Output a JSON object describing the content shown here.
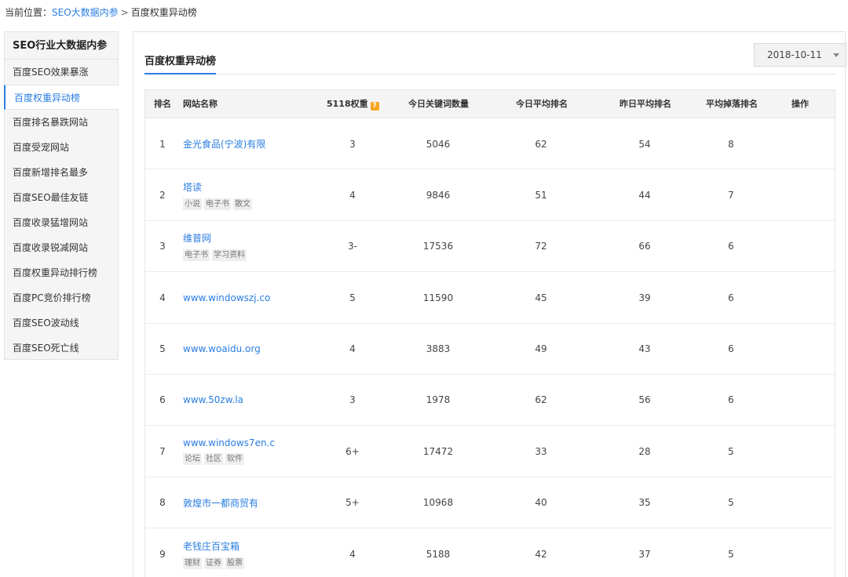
{
  "breadcrumb": {
    "prefix": "当前位置：",
    "link": "SEO大数据内参",
    "separator": ">",
    "current": "百度权重异动榜"
  },
  "sidebar": {
    "title": "SEO行业大数据内参",
    "items": [
      {
        "label": "百度SEO效果暴涨",
        "active": false
      },
      {
        "label": "百度权重异动榜",
        "active": true
      },
      {
        "label": "百度排名暴跌网站",
        "active": false
      },
      {
        "label": "百度受宠网站",
        "active": false
      },
      {
        "label": "百度新增排名最多",
        "active": false
      },
      {
        "label": "百度SEO最佳友链",
        "active": false
      },
      {
        "label": "百度收录猛增网站",
        "active": false
      },
      {
        "label": "百度收录锐减网站",
        "active": false
      },
      {
        "label": "百度权重异动排行榜",
        "active": false
      },
      {
        "label": "百度PC竞价排行榜",
        "active": false
      },
      {
        "label": "百度SEO波动线",
        "active": false
      },
      {
        "label": "百度SEO死亡线",
        "active": false
      }
    ]
  },
  "main": {
    "tab": "百度权重异动榜",
    "date": "2018-10-11"
  },
  "table": {
    "headers": {
      "rank": "排名",
      "name": "网站名称",
      "weight": "5118权重",
      "help": "?",
      "keywords": "今日关键词数量",
      "today": "今日平均排名",
      "yesterday": "昨日平均排名",
      "drop": "平均掉落排名",
      "op": "操作"
    },
    "rows": [
      {
        "rank": "1",
        "name": "金光食品(宁波)有限",
        "tags": [],
        "weight": "3",
        "keywords": "5046",
        "today": "62",
        "yesterday": "54",
        "drop": "8"
      },
      {
        "rank": "2",
        "name": "塔读",
        "tags": [
          "小说",
          "电子书",
          "散文"
        ],
        "weight": "4",
        "keywords": "9846",
        "today": "51",
        "yesterday": "44",
        "drop": "7"
      },
      {
        "rank": "3",
        "name": "维普网",
        "tags": [
          "电子书",
          "学习资料"
        ],
        "weight": "3-",
        "keywords": "17536",
        "today": "72",
        "yesterday": "66",
        "drop": "6"
      },
      {
        "rank": "4",
        "name": "www.windowszj.co",
        "tags": [],
        "weight": "5",
        "keywords": "11590",
        "today": "45",
        "yesterday": "39",
        "drop": "6"
      },
      {
        "rank": "5",
        "name": "www.woaidu.org",
        "tags": [],
        "weight": "4",
        "keywords": "3883",
        "today": "49",
        "yesterday": "43",
        "drop": "6"
      },
      {
        "rank": "6",
        "name": "www.50zw.la",
        "tags": [],
        "weight": "3",
        "keywords": "1978",
        "today": "62",
        "yesterday": "56",
        "drop": "6"
      },
      {
        "rank": "7",
        "name": "www.windows7en.c",
        "tags": [
          "论坛",
          "社区",
          "软件"
        ],
        "weight": "6+",
        "keywords": "17472",
        "today": "33",
        "yesterday": "28",
        "drop": "5"
      },
      {
        "rank": "8",
        "name": "敦煌市一都商贸有",
        "tags": [],
        "weight": "5+",
        "keywords": "10968",
        "today": "40",
        "yesterday": "35",
        "drop": "5"
      },
      {
        "rank": "9",
        "name": "老钱庄百宝箱",
        "tags": [
          "理财",
          "证券",
          "股票"
        ],
        "weight": "4",
        "keywords": "5188",
        "today": "42",
        "yesterday": "37",
        "drop": "5"
      }
    ]
  }
}
